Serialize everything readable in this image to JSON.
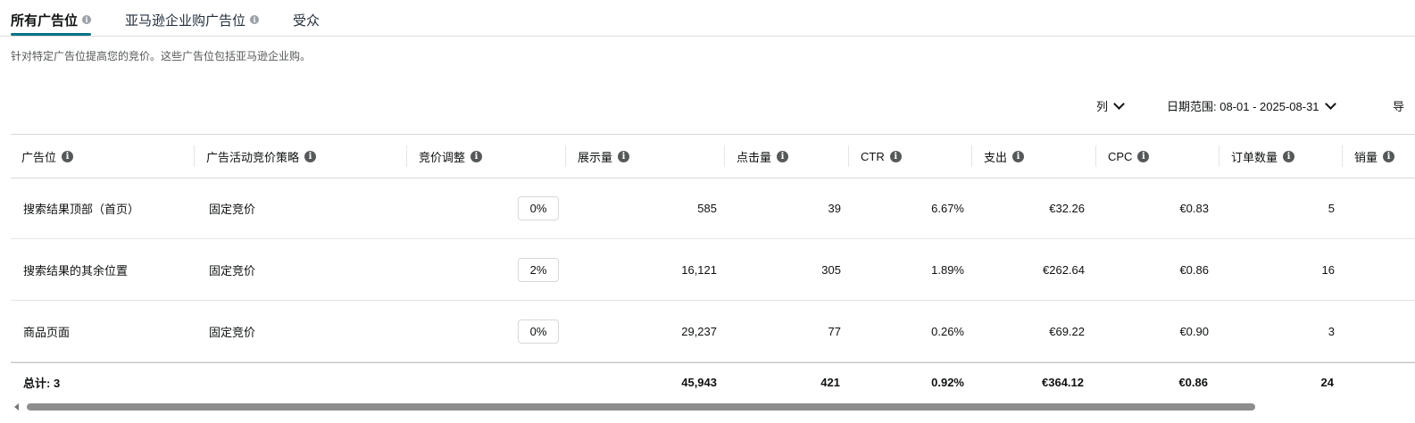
{
  "tabs": [
    {
      "label": "所有广告位",
      "active": true,
      "info_icon": true
    },
    {
      "label": "亚马逊企业购广告位",
      "active": false,
      "info_icon": true
    },
    {
      "label": "受众",
      "active": false,
      "info_icon": false
    }
  ],
  "description": "针对特定广告位提高您的竞价。这些广告位包括亚马逊企业购。",
  "toolbar": {
    "columns_label": "列",
    "date_range_label": "日期范围: 08-01 - 2025-08-31",
    "export_partial": "导"
  },
  "table": {
    "headers": [
      "广告位",
      "广告活动竞价策略",
      "竞价调整",
      "展示量",
      "点击量",
      "CTR",
      "支出",
      "CPC",
      "订单数量",
      "销量"
    ],
    "rows": [
      {
        "placement": "搜索结果顶部（首页）",
        "strategy": "固定竞价",
        "bid_adjustment": "0%",
        "impressions": "585",
        "clicks": "39",
        "ctr": "6.67%",
        "spend": "€32.26",
        "cpc": "€0.83",
        "orders": "5"
      },
      {
        "placement": "搜索结果的其余位置",
        "strategy": "固定竞价",
        "bid_adjustment": "2%",
        "impressions": "16,121",
        "clicks": "305",
        "ctr": "1.89%",
        "spend": "€262.64",
        "cpc": "€0.86",
        "orders": "16"
      },
      {
        "placement": "商品页面",
        "strategy": "固定竞价",
        "bid_adjustment": "0%",
        "impressions": "29,237",
        "clicks": "77",
        "ctr": "0.26%",
        "spend": "€69.22",
        "cpc": "€0.90",
        "orders": "3"
      }
    ],
    "totals": {
      "label": "总计: 3",
      "impressions": "45,943",
      "clicks": "421",
      "ctr": "0.92%",
      "spend": "€364.12",
      "cpc": "€0.86",
      "orders": "24"
    }
  },
  "colors": {
    "tab_underline": "#007185",
    "border": "#d5d9d9",
    "text": "#0f1111",
    "muted": "#565959"
  }
}
